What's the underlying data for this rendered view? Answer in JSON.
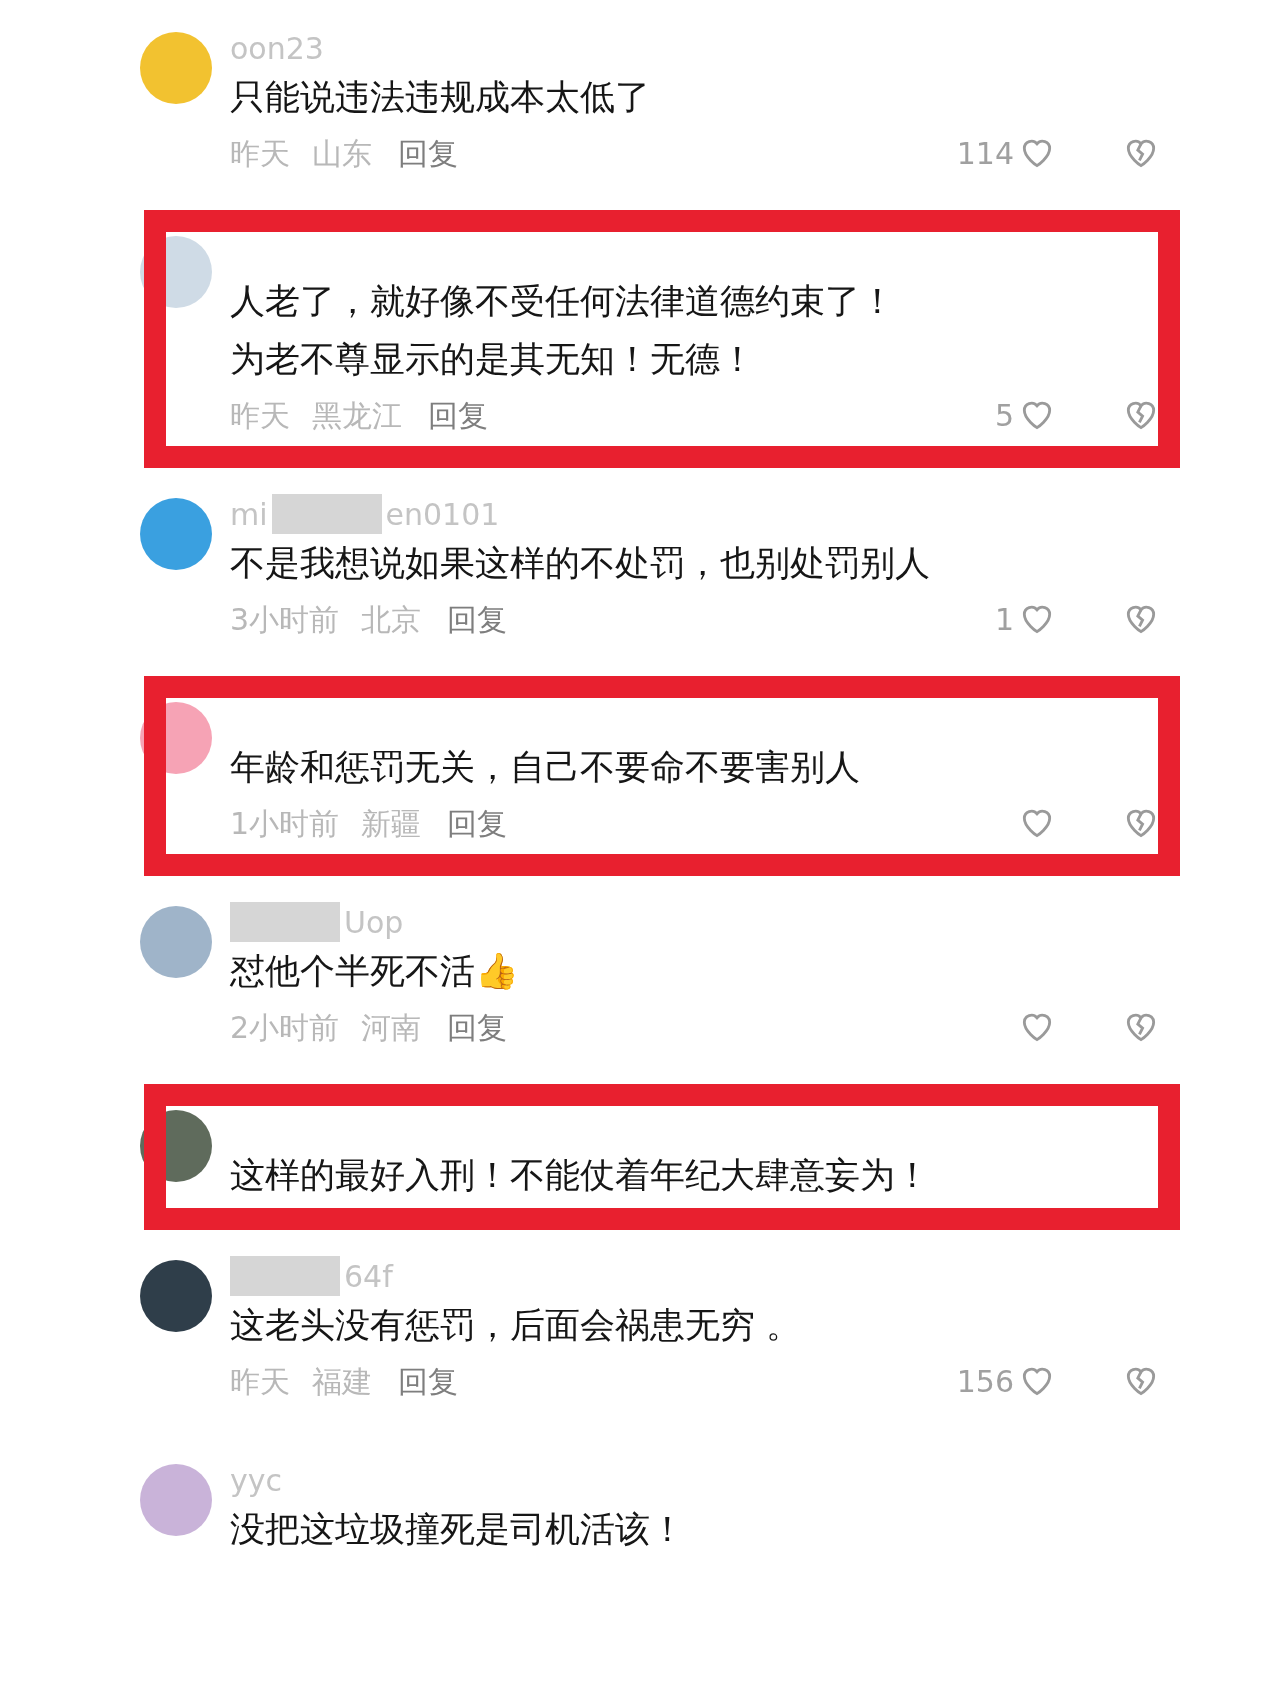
{
  "comments": [
    {
      "username": [
        {
          "kind": "text",
          "text": "oon23"
        }
      ],
      "highlighted": false,
      "lines": [
        "只能说违法违规成本太低了"
      ],
      "meta": {
        "time": "昨天",
        "location": "山东",
        "reply": "回复",
        "likes": "114"
      }
    },
    {
      "highlighted": true,
      "lines": [
        "人老了，就好像不受任何法律道德约束了！",
        "为老不尊显示的是其无知！无德！"
      ],
      "meta": {
        "time": "昨天",
        "location": "黑龙江",
        "reply": "回复",
        "likes": "5"
      }
    },
    {
      "username": [
        {
          "kind": "text",
          "text": "mi"
        },
        {
          "kind": "redaction"
        },
        {
          "kind": "text",
          "text": "en0101"
        }
      ],
      "highlighted": false,
      "lines": [
        "不是我想说如果这样的不处罚，也别处罚别人"
      ],
      "meta": {
        "time": "3小时前",
        "location": "北京",
        "reply": "回复",
        "likes": "1"
      }
    },
    {
      "highlighted": true,
      "lines": [
        "年龄和惩罚无关，自己不要命不要害别人"
      ],
      "meta": {
        "time": "1小时前",
        "location": "新疆",
        "reply": "回复"
      }
    },
    {
      "username": [
        {
          "kind": "redaction"
        },
        {
          "kind": "text",
          "text": "Uop"
        }
      ],
      "highlighted": false,
      "lines": [
        "怼他个半死不活👍"
      ],
      "meta": {
        "time": "2小时前",
        "location": "河南",
        "reply": "回复"
      }
    },
    {
      "highlighted": true,
      "lines": [
        "这样的最好入刑！不能仗着年纪大肆意妄为！"
      ]
    },
    {
      "username": [
        {
          "kind": "redaction"
        },
        {
          "kind": "text",
          "text": "64f"
        }
      ],
      "highlighted": false,
      "lines": [
        "这老头没有惩罚，后面会祸患无穷 。"
      ],
      "meta": {
        "time": "昨天",
        "location": "福建",
        "reply": "回复",
        "likes": "156"
      }
    },
    {
      "username": [
        {
          "kind": "text",
          "text": "yyc"
        }
      ],
      "highlighted": false,
      "lines": [
        "没把这垃圾撞死是司机活该！"
      ]
    }
  ]
}
